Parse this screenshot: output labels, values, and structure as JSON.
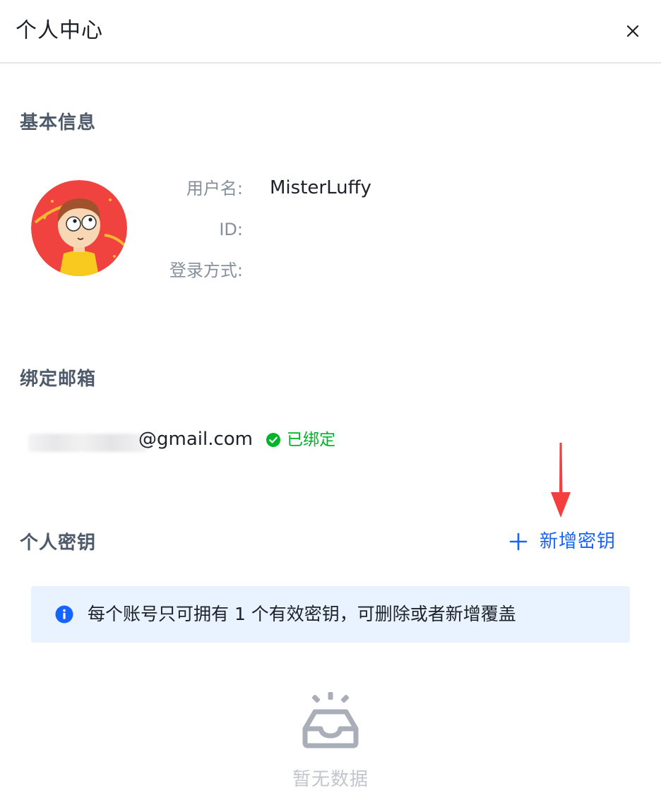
{
  "header": {
    "title": "个人中心",
    "close_icon": "close-icon"
  },
  "basic_info": {
    "section_title": "基本信息",
    "avatar_icon": "avatar-cartoon-character",
    "fields": [
      {
        "label": "用户名:",
        "value": "MisterLuffy"
      },
      {
        "label": "ID:",
        "value": ""
      },
      {
        "label": "登录方式:",
        "value": ""
      }
    ]
  },
  "email": {
    "section_title": "绑定邮箱",
    "address_visible": "@gmail.com",
    "status_icon": "check-circle-icon",
    "status_text": "已绑定"
  },
  "keys": {
    "section_title": "个人密钥",
    "add_icon": "plus-icon",
    "add_label": "新增密钥",
    "annotation_icon": "red-arrow-down-icon",
    "notice_icon": "info-circle-icon",
    "notice_text": "每个账号只可拥有 1 个有效密钥，可删除或者新增覆盖",
    "empty_icon": "empty-inbox-icon",
    "empty_text": "暂无数据"
  },
  "colors": {
    "primary": "#1664ff",
    "success": "#00b42a",
    "notice_bg": "#e8f3ff",
    "annotation": "#f53f3f"
  }
}
